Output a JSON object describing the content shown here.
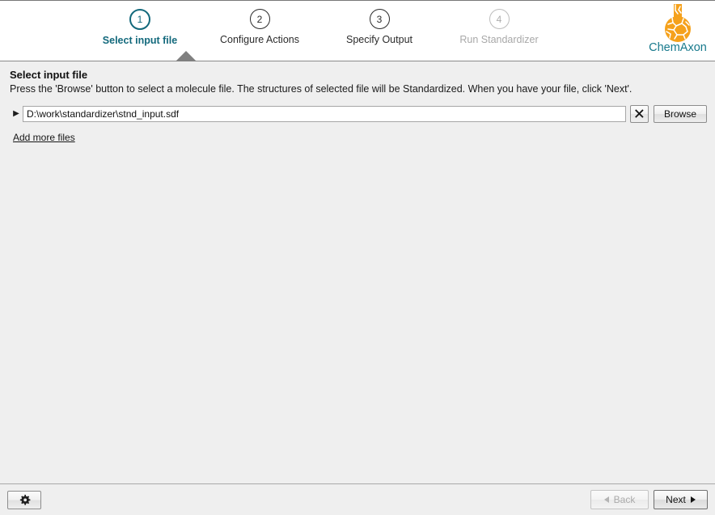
{
  "wizard": {
    "steps": [
      {
        "number": "1",
        "label": "Select input file",
        "state": "active"
      },
      {
        "number": "2",
        "label": "Configure Actions",
        "state": "enabled"
      },
      {
        "number": "3",
        "label": "Specify Output",
        "state": "enabled"
      },
      {
        "number": "4",
        "label": "Run Standardizer",
        "state": "future"
      }
    ],
    "active_color": "#13697c",
    "enabled_color": "#2b2b2b",
    "future_color": "#a8a8a8"
  },
  "brand": {
    "name": "ChemAxon",
    "logo_icon": "flask-icon",
    "logo_color": "#f6a11a",
    "text_color": "#17798c"
  },
  "page": {
    "title": "Select input file",
    "instructions": "Press the 'Browse' button to select a molecule file. The structures of selected file will be Standardized. When you have your file, click 'Next'."
  },
  "file_selector": {
    "expander_icon": "triangle-right-icon",
    "input_value": "D:\\work\\standardizer\\stnd_input.sdf",
    "input_placeholder": "",
    "clear_label": "✕",
    "browse_label": "Browse",
    "add_more_label": "Add more files"
  },
  "footer": {
    "settings_icon": "gear-icon",
    "back_label": "Back",
    "next_label": "Next",
    "back_enabled": false,
    "next_enabled": true
  }
}
